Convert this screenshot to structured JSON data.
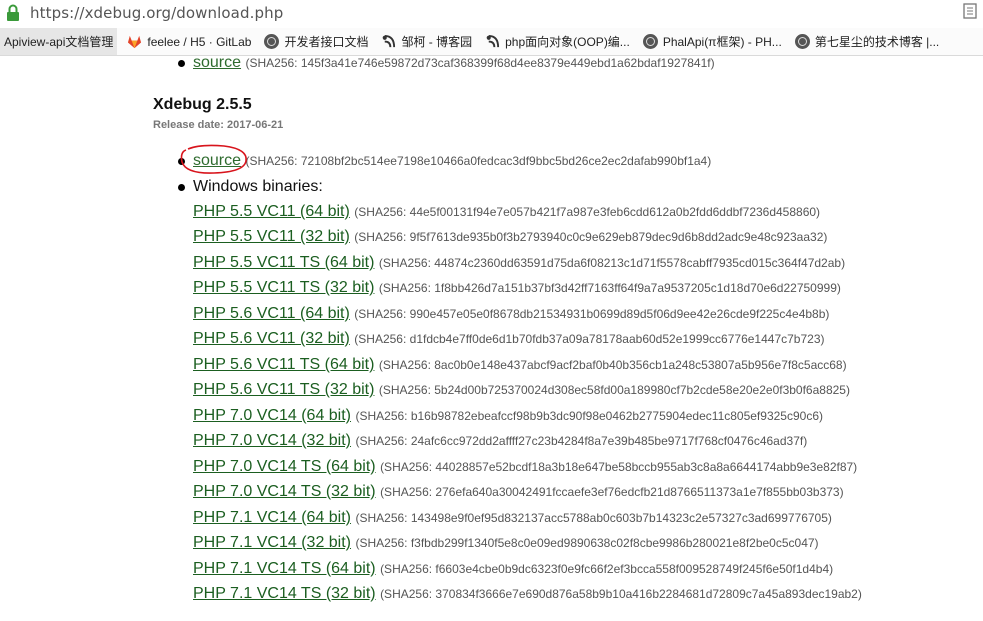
{
  "browser": {
    "url": "https://xdebug.org/download.php",
    "bookmarks": [
      {
        "label": "Apiview-api文档管理",
        "icon": "none"
      },
      {
        "label": "feelee / H5 · GitLab",
        "icon": "gitlab-icon"
      },
      {
        "label": "开发者接口文档",
        "icon": "globe-icon"
      },
      {
        "label": "邹柯 - 博客园",
        "icon": "cnblogs-icon"
      },
      {
        "label": "php面向对象(OOP)编...",
        "icon": "cnblogs-icon"
      },
      {
        "label": "PhalApi(π框架) - PH...",
        "icon": "globe-icon"
      },
      {
        "label": "第七星尘的技术博客 |...",
        "icon": "globe-icon"
      }
    ]
  },
  "top": {
    "link": "source",
    "sha": "(SHA256: 145f3a41e746e59872d73caf368399f68d4ee8379e449ebd1a62bdaf1927841f)"
  },
  "release": {
    "title": "Xdebug 2.5.5",
    "date": "Release date: 2017-06-21",
    "source_link": "source",
    "source_sha": "(SHA256: 72108bf2bc514ee7198e10466a0fedcac3df9bbc5bd26ce2ec2dafab990bf1a4)",
    "windows_label": "Windows binaries:",
    "binaries": [
      {
        "label": "PHP 5.5 VC11 (64 bit)",
        "sha": "(SHA256: 44e5f00131f94e7e057b421f7a987e3feb6cdd612a0b2fdd6ddbf7236d458860)"
      },
      {
        "label": "PHP 5.5 VC11 (32 bit)",
        "sha": "(SHA256: 9f5f7613de935b0f3b2793940c0c9e629eb879dec9d6b8dd2adc9e48c923aa32)"
      },
      {
        "label": "PHP 5.5 VC11 TS (64 bit)",
        "sha": "(SHA256: 44874c2360dd63591d75da6f08213c1d71f5578cabff7935cd015c364f47d2ab)"
      },
      {
        "label": "PHP 5.5 VC11 TS (32 bit)",
        "sha": "(SHA256: 1f8bb426d7a151b37bf3d42ff7163ff64f9a7a9537205c1d18d70e6d22750999)"
      },
      {
        "label": "PHP 5.6 VC11 (64 bit)",
        "sha": "(SHA256: 990e457e05e0f8678db21534931b0699d89d5f06d9ee42e26cde9f225c4e4b8b)"
      },
      {
        "label": "PHP 5.6 VC11 (32 bit)",
        "sha": "(SHA256: d1fdcb4e7ff0de6d1b70fdb37a09a78178aab60d52e1999cc6776e1447c7b723)"
      },
      {
        "label": "PHP 5.6 VC11 TS (64 bit)",
        "sha": "(SHA256: 8ac0b0e148e437abcf9acf2baf0b40b356cb1a248c53807a5b956e7f8c5acc68)"
      },
      {
        "label": "PHP 5.6 VC11 TS (32 bit)",
        "sha": "(SHA256: 5b24d00b725370024d308ec58fd00a189980cf7b2cde58e20e2e0f3b0f6a8825)"
      },
      {
        "label": "PHP 7.0 VC14 (64 bit)",
        "sha": "(SHA256: b16b98782ebeafccf98b9b3dc90f98e0462b2775904edec11c805ef9325c90c6)"
      },
      {
        "label": "PHP 7.0 VC14 (32 bit)",
        "sha": "(SHA256: 24afc6cc972dd2affff27c23b4284f8a7e39b485be9717f768cf0476c46ad37f)"
      },
      {
        "label": "PHP 7.0 VC14 TS (64 bit)",
        "sha": "(SHA256: 44028857e52bcdf18a3b18e647be58bccb955ab3c8a8a6644174abb9e3e82f87)"
      },
      {
        "label": "PHP 7.0 VC14 TS (32 bit)",
        "sha": "(SHA256: 276efa640a30042491fccaefe3ef76edcfb21d8766511373a1e7f855bb03b373)"
      },
      {
        "label": "PHP 7.1 VC14 (64 bit)",
        "sha": "(SHA256: 143498e9f0ef95d832137acc5788ab0c603b7b14323c2e57327c3ad699776705)"
      },
      {
        "label": "PHP 7.1 VC14 (32 bit)",
        "sha": "(SHA256: f3fbdb299f1340f5e8c0e09ed9890638c02f8cbe9986b280021e8f2be0c5c047)"
      },
      {
        "label": "PHP 7.1 VC14 TS (64 bit)",
        "sha": "(SHA256: f6603e4cbe0b9dc6323f0e9fc66f2ef3bcca558f009528749f245f6e50f1d4b4)"
      },
      {
        "label": "PHP 7.1 VC14 TS (32 bit)",
        "sha": "(SHA256: 370834f3666e7e690d876a58b9b10a416b2284681d72809c7a45a893dec19ab2)"
      }
    ]
  },
  "colors": {
    "link": "#1b5e20",
    "annotation": "#d8141c",
    "lock": "#3a9a3a"
  }
}
